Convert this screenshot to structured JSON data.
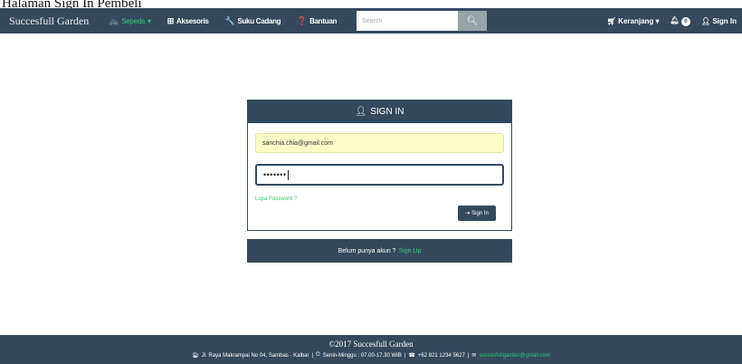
{
  "page_caption": "Halaman Sign In Pembeli",
  "navbar": {
    "brand": "Succesfull Garden",
    "items": [
      {
        "label": "Sepeda",
        "icon": "bicycle-icon"
      },
      {
        "label": "Aksesoris",
        "icon": "plus-box-icon"
      },
      {
        "label": "Suku Cadang",
        "icon": "wrench-icon"
      },
      {
        "label": "Bantuan",
        "icon": "question-circle-icon"
      }
    ],
    "search_placeholder": "Search",
    "cart_label": "Keranjang",
    "notification_count": "0",
    "signin_label": "Sign In"
  },
  "signin_panel": {
    "title": "SIGN IN",
    "email_value": "sanchia.chia@gmail.com",
    "password_mask": "•••••••",
    "forgot_label": "Lupa Password ?",
    "button_label": "Sign In"
  },
  "signup_bar": {
    "text": "Belum punya akun ?",
    "link": "Sign Up"
  },
  "footer": {
    "copyright": "©2017 Succesfull Garden",
    "address": "Jl. Raya Makrampai No 04, Sambas - Kalbar",
    "hours": "Senin-Minggu : 07.00-17.30 WIB",
    "phone": "+62 821 1234 5627",
    "email": "succesfullgarden@gmail.com"
  },
  "colors": {
    "primary": "#34495e",
    "accent_green": "#2ecc71",
    "search_button": "#95a5a6",
    "autofill": "#fafcc6"
  }
}
